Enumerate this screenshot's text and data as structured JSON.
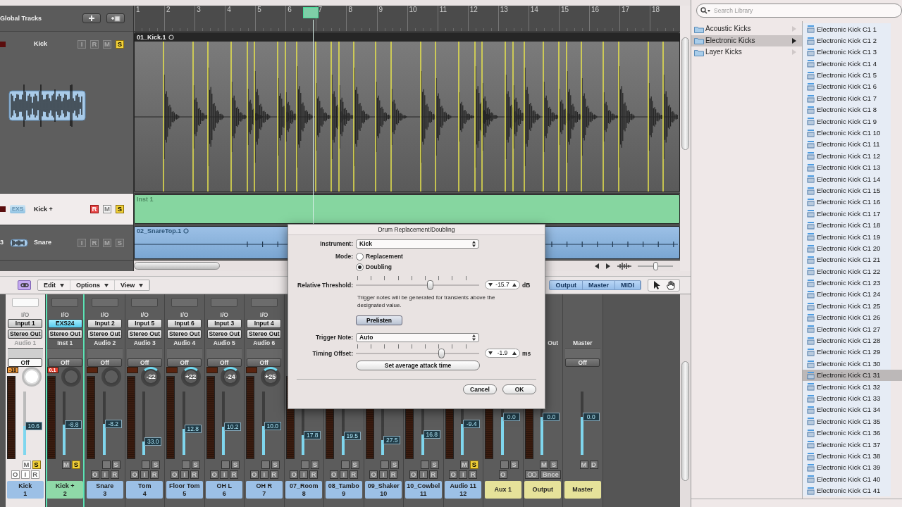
{
  "arrange": {
    "global_tracks": {
      "label": "Global Tracks"
    },
    "ruler": {
      "bars": [
        "1",
        "2",
        "3",
        "4",
        "5",
        "6",
        "7",
        "8",
        "9",
        "10",
        "11",
        "12",
        "13",
        "14",
        "15",
        "16",
        "17",
        "18"
      ]
    },
    "tracks": [
      {
        "name": "Kick",
        "selected": false,
        "buttons": [
          {
            "kind": "input",
            "label": "I",
            "on": false
          },
          {
            "kind": "record",
            "label": "R",
            "on": false
          },
          {
            "kind": "mute",
            "label": "M",
            "on": false
          },
          {
            "kind": "solo",
            "label": "S",
            "on": true
          }
        ],
        "region": {
          "kind": "transients",
          "name": "01_Kick.1"
        }
      },
      {
        "name": "Kick +",
        "icon_label": "EXS",
        "selected": true,
        "buttons": [
          {
            "kind": "record",
            "label": "R",
            "on": true
          },
          {
            "kind": "mute",
            "label": "M",
            "on": false
          },
          {
            "kind": "solo",
            "label": "S",
            "on": true
          }
        ],
        "region": {
          "kind": "midi",
          "name": "Inst 1"
        }
      },
      {
        "number": "3",
        "name": "Snare",
        "selected": false,
        "buttons": [
          {
            "kind": "input",
            "label": "I",
            "on": false
          },
          {
            "kind": "record",
            "label": "R",
            "on": false
          },
          {
            "kind": "mute",
            "label": "M",
            "on": false
          },
          {
            "kind": "solo",
            "label": "S",
            "on": false
          }
        ],
        "region": {
          "kind": "audio",
          "name": "02_SnareTop.1"
        }
      }
    ],
    "zoom": {
      "level": 0.5
    }
  },
  "mixer": {
    "toolbar": {
      "menus": [
        "Edit",
        "Options",
        "View"
      ],
      "filters": [
        {
          "label": "Output",
          "selected": true
        },
        {
          "label": "Master",
          "selected": true
        },
        {
          "label": "MIDI",
          "selected": true
        }
      ]
    },
    "strips": [
      {
        "kind": "audio",
        "selected": true,
        "outlined": false,
        "io": "I/O",
        "input": "Input 1",
        "output": "Stereo Out",
        "channel": "Audio 1",
        "automation": "Off",
        "peak": "-18",
        "clip": false,
        "fader": "10.6",
        "level": 0.46,
        "buttons": [
          {
            "kind": "mute",
            "label": "M",
            "on": false
          },
          {
            "kind": "solo",
            "label": "S",
            "on": true
          }
        ],
        "bottom": [
          {
            "kind": "output",
            "label": "O"
          },
          {
            "kind": "input",
            "label": "I"
          },
          {
            "kind": "record",
            "label": "R"
          }
        ],
        "name": "Kick",
        "number": "1",
        "color": "#9cc0e6"
      },
      {
        "kind": "instrument",
        "selected": false,
        "outlined": true,
        "io": "I/O",
        "input": "EXS24",
        "output": "Stereo Out",
        "channel": "Inst 1",
        "automation": "Off",
        "peak": "0.1",
        "clip": true,
        "fader": "-8.8",
        "level": 0.48,
        "buttons": [
          {
            "kind": "mute",
            "label": "M",
            "on": false
          },
          {
            "kind": "solo",
            "label": "S",
            "on": true
          }
        ],
        "name": "Kick +",
        "number": "2",
        "color": "#8fd9a8"
      },
      {
        "kind": "audio",
        "selected": false,
        "outlined": false,
        "io": "I/O",
        "input": "Input 2",
        "output": "Stereo Out",
        "channel": "Audio 2",
        "automation": "Off",
        "fader": "-8.2",
        "level": 0.49,
        "buttons": [
          {
            "kind": "mute",
            "on": false
          },
          {
            "kind": "solo",
            "label": "S",
            "on": false
          }
        ],
        "bottom": [
          {
            "kind": "output",
            "label": "O"
          },
          {
            "kind": "input",
            "label": "I"
          },
          {
            "kind": "record",
            "label": "R"
          }
        ],
        "name": "Snare",
        "number": "3",
        "color": "#9cc0e6"
      },
      {
        "kind": "audio",
        "selected": false,
        "outlined": false,
        "io": "I/O",
        "input": "Input 5",
        "output": "Stereo Out",
        "channel": "Audio 3",
        "automation": "Off",
        "pan": "-22",
        "fader": "33.0",
        "level": 0.21,
        "buttons": [
          {
            "kind": "mute",
            "on": false
          },
          {
            "kind": "solo",
            "label": "S",
            "on": false
          }
        ],
        "bottom": [
          {
            "kind": "output",
            "label": "O"
          },
          {
            "kind": "input",
            "label": "I"
          },
          {
            "kind": "record",
            "label": "R"
          }
        ],
        "name": "Tom",
        "number": "4",
        "color": "#9cc0e6"
      },
      {
        "kind": "audio",
        "selected": false,
        "outlined": false,
        "io": "I/O",
        "input": "Input 6",
        "output": "Stereo Out",
        "channel": "Audio 4",
        "automation": "Off",
        "pan": "+22",
        "fader": "12.8",
        "level": 0.41,
        "buttons": [
          {
            "kind": "mute",
            "on": false
          },
          {
            "kind": "solo",
            "label": "S",
            "on": false
          }
        ],
        "bottom": [
          {
            "kind": "output",
            "label": "O"
          },
          {
            "kind": "input",
            "label": "I"
          },
          {
            "kind": "record",
            "label": "R"
          }
        ],
        "name": "Floor Tom",
        "number": "5",
        "color": "#9cc0e6"
      },
      {
        "kind": "audio",
        "selected": false,
        "outlined": false,
        "io": "I/O",
        "input": "Input 3",
        "output": "Stereo Out",
        "channel": "Audio 5",
        "automation": "Off",
        "pan": "-24",
        "fader": "10.2",
        "level": 0.44,
        "buttons": [
          {
            "kind": "mute",
            "on": false
          },
          {
            "kind": "solo",
            "label": "S",
            "on": false
          }
        ],
        "bottom": [
          {
            "kind": "output",
            "label": "O"
          },
          {
            "kind": "input",
            "label": "I"
          },
          {
            "kind": "record",
            "label": "R"
          }
        ],
        "name": "OH L",
        "number": "6",
        "color": "#9cc0e6"
      },
      {
        "kind": "audio",
        "selected": false,
        "outlined": false,
        "io": "I/O",
        "input": "Input 4",
        "output": "Stereo Out",
        "channel": "Audio 6",
        "automation": "Off",
        "pan": "+25",
        "fader": "10.0",
        "level": 0.46,
        "buttons": [
          {
            "kind": "mute",
            "on": false
          },
          {
            "kind": "solo",
            "label": "S",
            "on": false
          }
        ],
        "bottom": [
          {
            "kind": "output",
            "label": "O"
          },
          {
            "kind": "input",
            "label": "I"
          },
          {
            "kind": "record",
            "label": "R"
          }
        ],
        "name": "OH R",
        "number": "7",
        "color": "#9cc0e6"
      },
      {
        "kind": "audio",
        "selected": false,
        "outlined": false,
        "fader": "17.8",
        "level": 0.31,
        "buttons": [
          {
            "kind": "mute",
            "on": false
          },
          {
            "kind": "solo",
            "label": "S",
            "on": false
          }
        ],
        "bottom": [
          {
            "kind": "output",
            "label": "O"
          },
          {
            "kind": "input",
            "label": "I"
          },
          {
            "kind": "record",
            "label": "R"
          }
        ],
        "name": "07_Room",
        "number": "8",
        "color": "#9cc0e6"
      },
      {
        "kind": "audio",
        "selected": false,
        "outlined": false,
        "fader": "19.5",
        "level": 0.3,
        "buttons": [
          {
            "kind": "mute",
            "on": false
          },
          {
            "kind": "solo",
            "label": "S",
            "on": false
          }
        ],
        "bottom": [
          {
            "kind": "output",
            "label": "O"
          },
          {
            "kind": "input",
            "label": "I"
          },
          {
            "kind": "record",
            "label": "R"
          }
        ],
        "name": "08_Tambo",
        "number": "9",
        "color": "#9cc0e6"
      },
      {
        "kind": "audio",
        "selected": false,
        "outlined": false,
        "fader": "27.5",
        "level": 0.23,
        "buttons": [
          {
            "kind": "mute",
            "on": false
          },
          {
            "kind": "solo",
            "label": "S",
            "on": false
          }
        ],
        "bottom": [
          {
            "kind": "output",
            "label": "O"
          },
          {
            "kind": "input",
            "label": "I"
          },
          {
            "kind": "record",
            "label": "R"
          }
        ],
        "name": "09_Shaker",
        "number": "10",
        "color": "#9cc0e6"
      },
      {
        "kind": "audio",
        "selected": false,
        "outlined": false,
        "fader": "16.8",
        "level": 0.32,
        "buttons": [
          {
            "kind": "mute",
            "on": false
          },
          {
            "kind": "solo",
            "label": "S",
            "on": false
          }
        ],
        "bottom": [
          {
            "kind": "output",
            "label": "O"
          },
          {
            "kind": "input",
            "label": "I"
          },
          {
            "kind": "record",
            "label": "R"
          }
        ],
        "name": "10_Cowbel",
        "number": "11",
        "color": "#9cc0e6"
      },
      {
        "kind": "audio",
        "selected": false,
        "outlined": false,
        "fader": "-9.4",
        "level": 0.49,
        "buttons": [
          {
            "kind": "mute",
            "label": "M",
            "on": false
          },
          {
            "kind": "solo",
            "label": "S",
            "on": true
          }
        ],
        "bottom": [
          {
            "kind": "output",
            "label": "O"
          },
          {
            "kind": "input",
            "label": "I"
          },
          {
            "kind": "record",
            "label": "R"
          }
        ],
        "name": "Audio 11",
        "number": "12",
        "color": "#9cc0e6"
      },
      {
        "kind": "aux",
        "selected": false,
        "outlined": false,
        "fader": "0.0",
        "level": 0.6,
        "buttons": [
          {
            "kind": "mute",
            "on": false
          },
          {
            "kind": "solo",
            "label": "S",
            "on": false
          }
        ],
        "bottom": [
          {
            "kind": "output",
            "label": "O"
          }
        ],
        "name": "Aux 1",
        "color": "#e6e29a"
      },
      {
        "kind": "output",
        "selected": false,
        "outlined": false,
        "channel": "Out",
        "fader": "0.0",
        "level": 0.6,
        "buttons": [
          {
            "kind": "mute",
            "label": "M",
            "on": false
          },
          {
            "kind": "solo",
            "label": "S",
            "on": false
          }
        ],
        "bottom": [
          {
            "kind": "link"
          },
          {
            "kind": "bounce",
            "label": "Bnce"
          }
        ],
        "name": "Output",
        "color": "#e6e29a"
      },
      {
        "kind": "master",
        "selected": false,
        "outlined": false,
        "channel": "Master",
        "automation": "Off",
        "fader": "0.0",
        "level": 0.6,
        "buttons": [
          {
            "kind": "mute",
            "label": "M",
            "on": false
          },
          {
            "kind": "dim",
            "label": "D",
            "on": false
          }
        ],
        "name": "Master",
        "color": "#e6e29a"
      }
    ]
  },
  "dialog": {
    "title": "Drum Replacement/Doubling",
    "instrument": {
      "label": "Instrument:",
      "value": "Kick"
    },
    "mode": {
      "label": "Mode:",
      "options": [
        {
          "label": "Replacement",
          "selected": false
        },
        {
          "label": "Doubling",
          "selected": true
        }
      ]
    },
    "threshold": {
      "label": "Relative Threshold:",
      "level": 0.6,
      "value": "-15.7",
      "unit": "dB"
    },
    "hint": "Trigger notes will be generated for transients above the designated value.",
    "prelisten": "Prelisten",
    "trigger_note": {
      "label": "Trigger Note:",
      "value": "Auto"
    },
    "timing_offset": {
      "label": "Timing Offset:",
      "level": 0.69,
      "value": "-1.9",
      "unit": "ms"
    },
    "attack_button": "Set average attack time",
    "buttons": [
      "Cancel",
      "OK"
    ]
  },
  "library": {
    "search": {
      "placeholder": "Search Library"
    },
    "folders": [
      {
        "label": "Acoustic Kicks",
        "selected": false
      },
      {
        "label": "Electronic Kicks",
        "selected": true
      },
      {
        "label": "Layer Kicks",
        "selected": false
      }
    ],
    "items": [
      {
        "label": "Electronic Kick C1 1",
        "selected": false
      },
      {
        "label": "Electronic Kick C1 2",
        "selected": false
      },
      {
        "label": "Electronic Kick C1 3",
        "selected": false
      },
      {
        "label": "Electronic Kick C1 4",
        "selected": false
      },
      {
        "label": "Electronic Kick C1 5",
        "selected": false
      },
      {
        "label": "Electronic Kick C1 6",
        "selected": false
      },
      {
        "label": "Electronic Kick C1 7",
        "selected": false
      },
      {
        "label": "Electronic Kick C1 8",
        "selected": false
      },
      {
        "label": "Electronic Kick C1 9",
        "selected": false
      },
      {
        "label": "Electronic Kick C1 10",
        "selected": false
      },
      {
        "label": "Electronic Kick C1 11",
        "selected": false
      },
      {
        "label": "Electronic Kick C1 12",
        "selected": false
      },
      {
        "label": "Electronic Kick C1 13",
        "selected": false
      },
      {
        "label": "Electronic Kick C1 14",
        "selected": false
      },
      {
        "label": "Electronic Kick C1 15",
        "selected": false
      },
      {
        "label": "Electronic Kick C1 16",
        "selected": false
      },
      {
        "label": "Electronic Kick C1 17",
        "selected": false
      },
      {
        "label": "Electronic Kick C1 18",
        "selected": false
      },
      {
        "label": "Electronic Kick C1 19",
        "selected": false
      },
      {
        "label": "Electronic Kick C1 20",
        "selected": false
      },
      {
        "label": "Electronic Kick C1 21",
        "selected": false
      },
      {
        "label": "Electronic Kick C1 22",
        "selected": false
      },
      {
        "label": "Electronic Kick C1 23",
        "selected": false
      },
      {
        "label": "Electronic Kick C1 24",
        "selected": false
      },
      {
        "label": "Electronic Kick C1 25",
        "selected": false
      },
      {
        "label": "Electronic Kick C1 26",
        "selected": false
      },
      {
        "label": "Electronic Kick C1 27",
        "selected": false
      },
      {
        "label": "Electronic Kick C1 28",
        "selected": false
      },
      {
        "label": "Electronic Kick C1 29",
        "selected": false
      },
      {
        "label": "Electronic Kick C1 30",
        "selected": false
      },
      {
        "label": "Electronic Kick C1 31",
        "selected": true
      },
      {
        "label": "Electronic Kick C1 32",
        "selected": false
      },
      {
        "label": "Electronic Kick C1 33",
        "selected": false
      },
      {
        "label": "Electronic Kick C1 34",
        "selected": false
      },
      {
        "label": "Electronic Kick C1 35",
        "selected": false
      },
      {
        "label": "Electronic Kick C1 36",
        "selected": false
      },
      {
        "label": "Electronic Kick C1 37",
        "selected": false
      },
      {
        "label": "Electronic Kick C1 38",
        "selected": false
      },
      {
        "label": "Electronic Kick C1 39",
        "selected": false
      },
      {
        "label": "Electronic Kick C1 40",
        "selected": false
      },
      {
        "label": "Electronic Kick C1 41",
        "selected": false
      }
    ]
  }
}
